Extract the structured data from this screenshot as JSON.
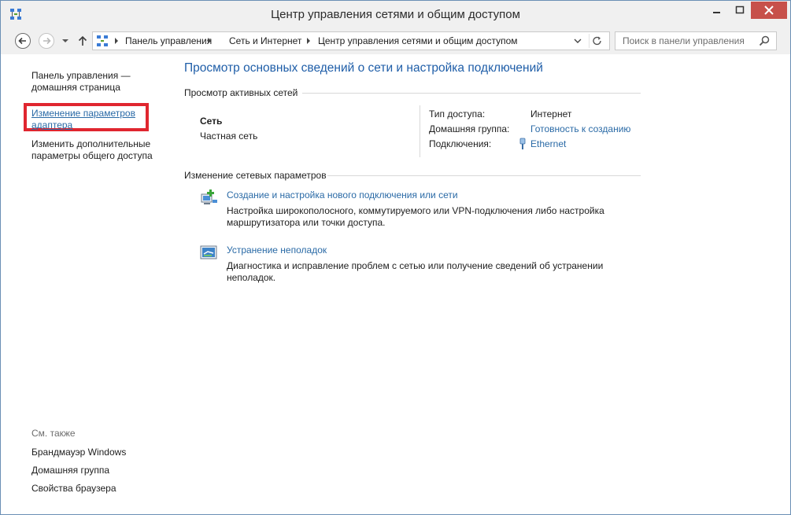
{
  "window": {
    "title": "Центр управления сетями и общим доступом"
  },
  "addressbar": {
    "crumbs": [
      "Панель управления",
      "Сеть и Интернет",
      "Центр управления сетями и общим доступом"
    ],
    "search_placeholder": "Поиск в панели управления"
  },
  "leftpane": {
    "home": "Панель управления — домашняя страница",
    "adapter": "Изменение параметров адаптера",
    "sharing": "Изменить дополнительные параметры общего доступа",
    "see_also": "См. также",
    "see_also_items": [
      "Брандмауэр Windows",
      "Домашняя группа",
      "Свойства браузера"
    ]
  },
  "main": {
    "title": "Просмотр основных сведений о сети и настройка подключений",
    "active_networks_header": "Просмотр активных сетей",
    "network_name": "Сеть",
    "network_category": "Частная сеть",
    "access_type_label": "Тип доступа:",
    "access_type_value": "Интернет",
    "homegroup_label": "Домашняя группа:",
    "homegroup_value": "Готовность к созданию",
    "connections_label": "Подключения:",
    "connections_value": "Ethernet",
    "change_header": "Изменение сетевых параметров",
    "task1_title": "Создание и настройка нового подключения или сети",
    "task1_desc": "Настройка широкополосного, коммутируемого или VPN-подключения либо настройка маршрутизатора или точки доступа.",
    "task2_title": "Устранение неполадок",
    "task2_desc": "Диагностика и исправление проблем с сетью или получение сведений об устранении неполадок."
  },
  "colors": {
    "link": "#2a6aa6",
    "title": "#1f5ea8",
    "highlight": "#e0262f",
    "close_button": "#c7504a"
  }
}
